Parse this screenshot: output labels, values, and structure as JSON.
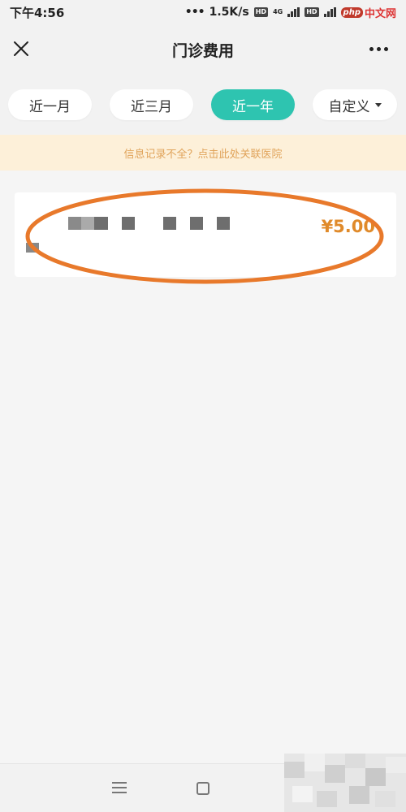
{
  "status_bar": {
    "time": "下午4:56",
    "speed": "1.5K/s",
    "hd_badge_1": "HD",
    "net": "4G",
    "hd_badge_2": "HD",
    "watermark_logo": "php",
    "watermark_text": "中文网"
  },
  "nav": {
    "title": "门诊费用"
  },
  "filters": {
    "tabs": [
      {
        "label": "近一月",
        "active": false
      },
      {
        "label": "近三月",
        "active": false
      },
      {
        "label": "近一年",
        "active": true
      }
    ],
    "custom_label": "自定义"
  },
  "notice": {
    "text": "信息记录不全？点击此处关联医院"
  },
  "records": [
    {
      "amount": "¥5.00"
    }
  ],
  "colors": {
    "accent": "#2ec4b0",
    "amount": "#e08a2a",
    "notice_bg": "#fdf0d9",
    "notice_text": "#e0a35a",
    "highlight_ring": "#e8792b"
  },
  "icons": {
    "close": "close-icon",
    "more": "more-dots-icon",
    "dropdown": "caret-down-icon",
    "menu": "menu-icon",
    "home": "home-square-icon"
  }
}
